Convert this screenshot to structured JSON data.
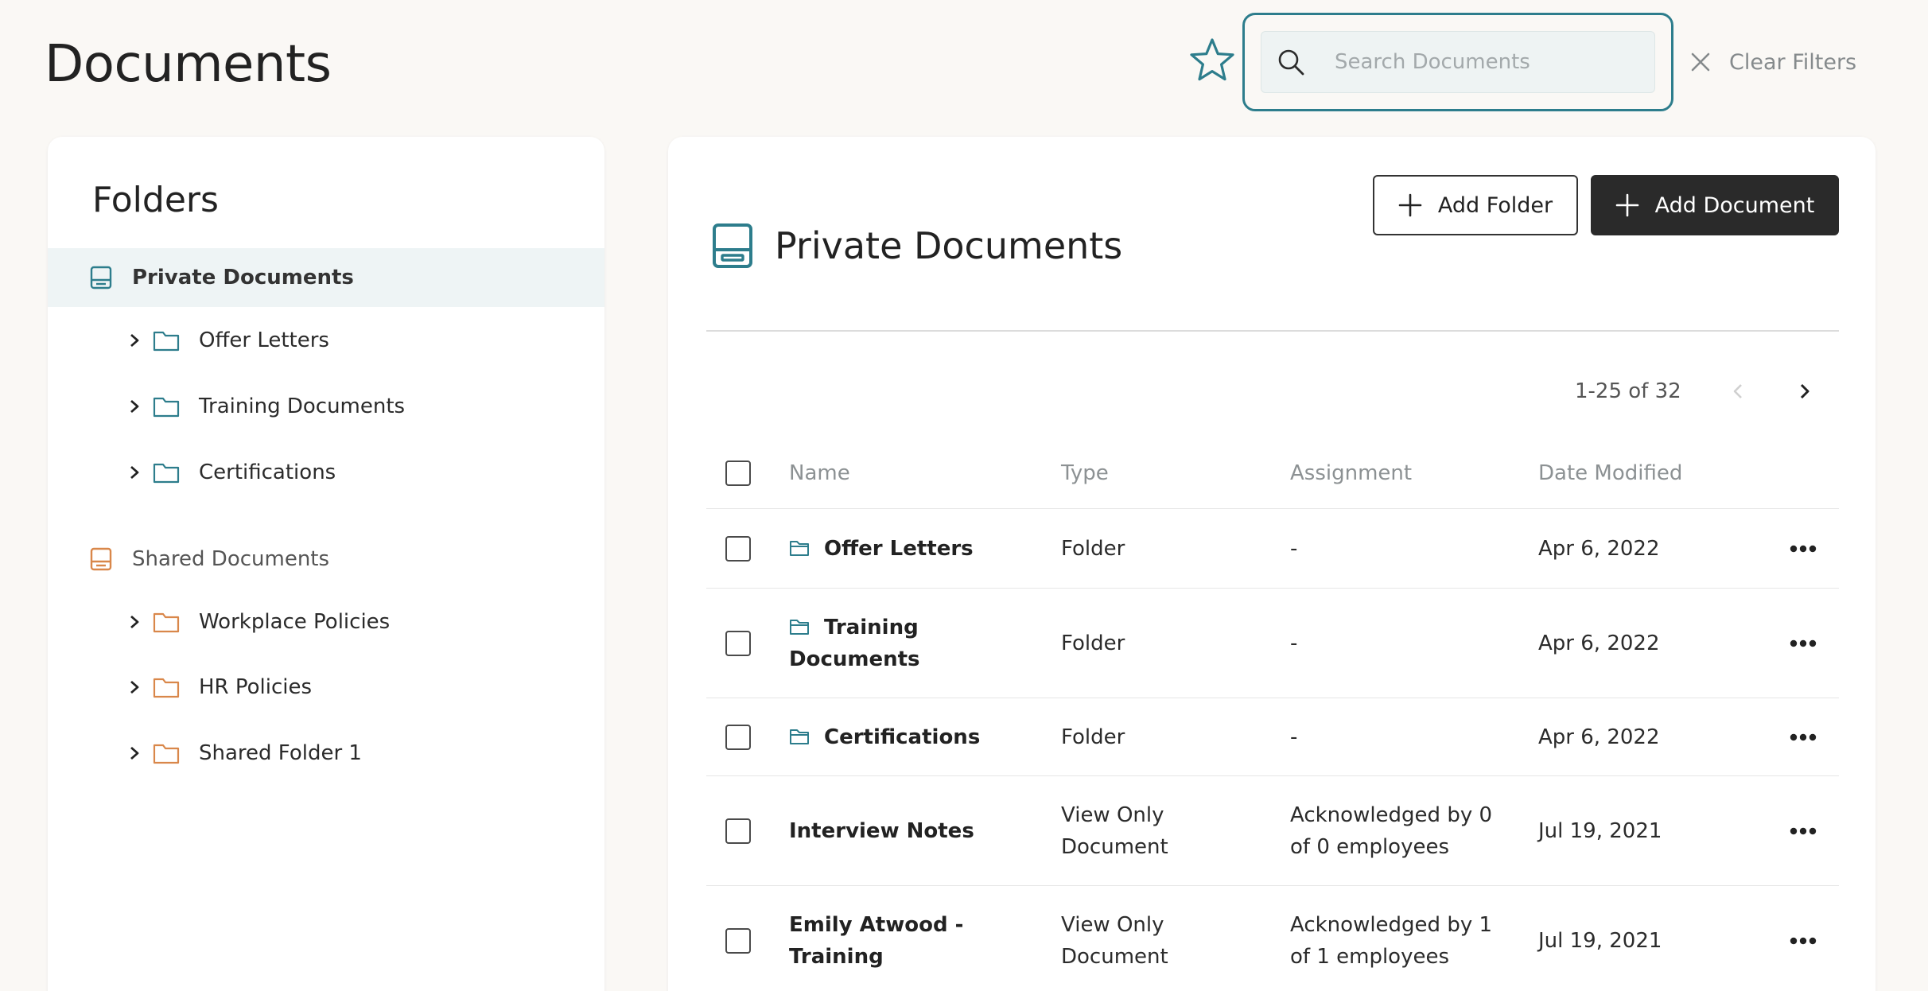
{
  "header": {
    "title": "Documents",
    "search_placeholder": "Search Documents",
    "clear_filters": "Clear Filters"
  },
  "colors": {
    "teal": "#2d7d8c",
    "orange": "#d9874a",
    "dark": "#2a2a2a"
  },
  "sidebar": {
    "title": "Folders",
    "private": {
      "label": "Private Documents",
      "folders": [
        "Offer Letters",
        "Training Documents",
        "Certifications"
      ]
    },
    "shared": {
      "label": "Shared Documents",
      "folders": [
        "Workplace Policies",
        "HR Policies",
        "Shared Folder 1"
      ]
    }
  },
  "main": {
    "title": "Private Documents",
    "add_folder": "Add Folder",
    "add_document": "Add Document",
    "pagination": "1-25 of 32",
    "columns": {
      "name": "Name",
      "type": "Type",
      "assignment": "Assignment",
      "date": "Date Modified"
    },
    "rows": [
      {
        "name": "Offer Letters",
        "type": "Folder",
        "assignment": "-",
        "date": "Apr 6, 2022",
        "is_folder": true
      },
      {
        "name": "Training Documents",
        "type": "Folder",
        "assignment": "-",
        "date": "Apr 6, 2022",
        "is_folder": true
      },
      {
        "name": "Certifications",
        "type": "Folder",
        "assignment": "-",
        "date": "Apr 6, 2022",
        "is_folder": true
      },
      {
        "name": "Interview Notes",
        "type": "View Only Document",
        "assignment": "Acknowledged by 0 of 0 employees",
        "date": "Jul 19, 2021",
        "is_folder": false
      },
      {
        "name": "Emily Atwood - Training",
        "type": "View Only Document",
        "assignment": "Acknowledged by 1 of 1 employees",
        "date": "Jul 19, 2021",
        "is_folder": false
      }
    ]
  }
}
